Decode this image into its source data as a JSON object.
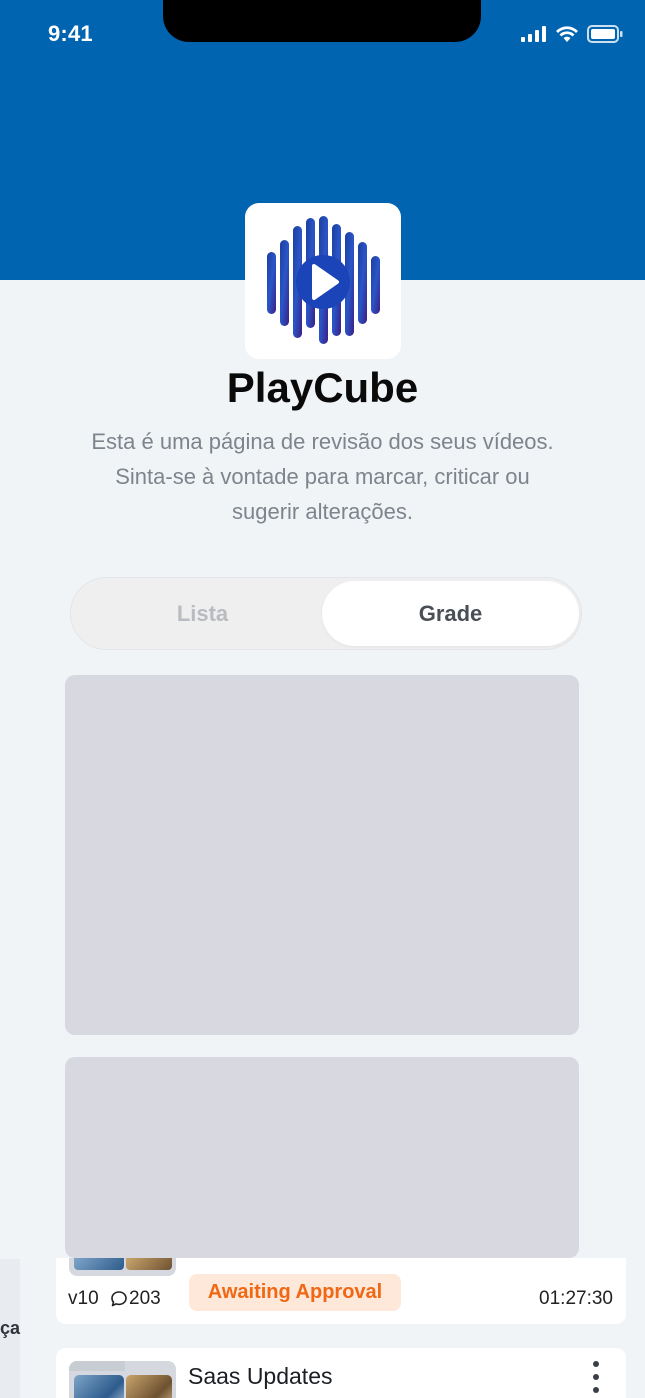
{
  "status_bar": {
    "time": "9:41"
  },
  "app": {
    "title": "PlayCube",
    "description": "Esta é uma página de revisão dos seus vídeos. Sinta-se à vontade para marcar, criticar ou sugerir alterações.",
    "logo_icon": "play-sound-wave-logo-icon"
  },
  "view_toggle": {
    "options": [
      "Lista",
      "Grade"
    ],
    "selected": "Grade"
  },
  "list": {
    "items": [
      {
        "version": "v10",
        "comments": "203",
        "status": "Awaiting Approval",
        "duration": "01:27:30"
      },
      {
        "title": "Saas Updates"
      }
    ],
    "left_strip_text": "ça"
  },
  "colors": {
    "header": "#0064b0",
    "background": "#f1f4f7",
    "skeleton": "#d8d8e0",
    "badge_bg": "#fde8da",
    "badge_text": "#f06714"
  }
}
